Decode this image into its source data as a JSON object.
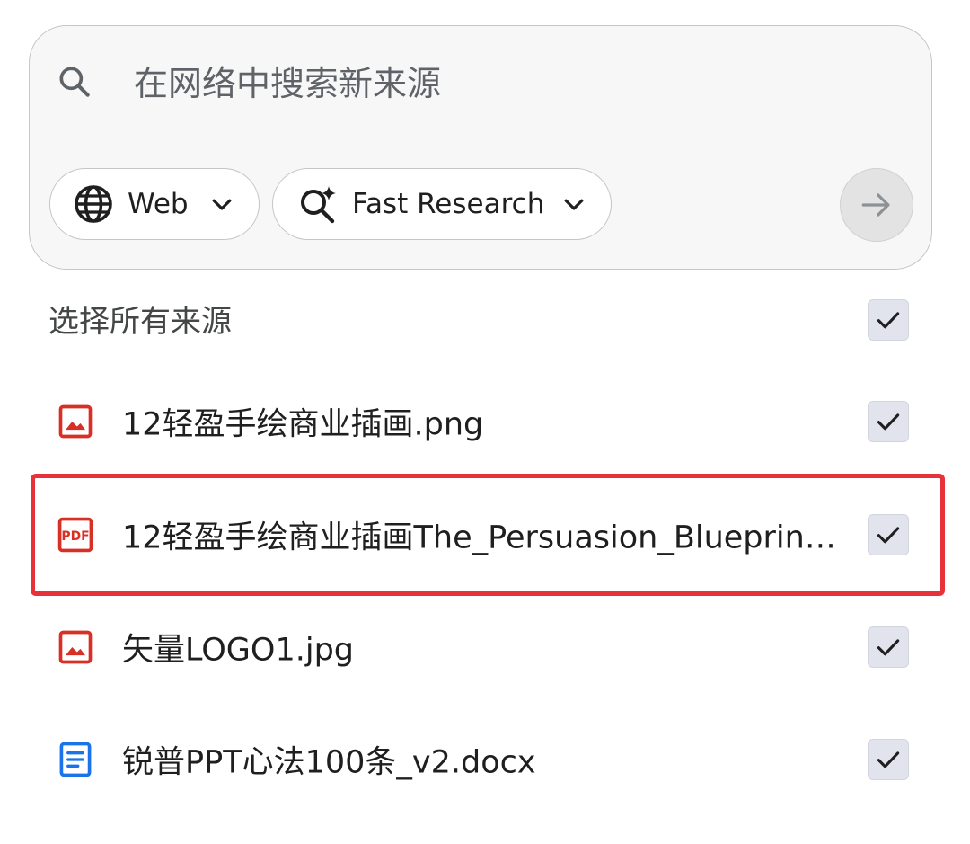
{
  "search": {
    "placeholder": "在网络中搜索新来源",
    "source_dropdown": {
      "label": "Web"
    },
    "mode_dropdown": {
      "label": "Fast Research"
    }
  },
  "select_all": {
    "label": "选择所有来源",
    "checked": true
  },
  "sources": [
    {
      "name": "12轻盈手绘商业插画.png",
      "type": "image",
      "checked": true
    },
    {
      "name": "12轻盈手绘商业插画The_Persuasion_Blueprint....",
      "type": "pdf",
      "checked": true,
      "highlighted": true
    },
    {
      "name": "矢量LOGO1.jpg",
      "type": "image",
      "checked": true
    },
    {
      "name": "锐普PPT心法100条_v2.docx",
      "type": "document",
      "checked": true
    }
  ],
  "colors": {
    "file_icon_red": "#d93025",
    "doc_icon_blue": "#1a73e8",
    "highlight": "#e8323a",
    "checkbox_bg": "#e1e3ed"
  },
  "icons": {
    "search": "search-icon",
    "web": "globe-icon",
    "mode": "sparkle-search-icon",
    "submit": "arrow-right-icon",
    "image": "image-file-icon",
    "pdf": "pdf-file-icon",
    "document": "document-file-icon"
  }
}
